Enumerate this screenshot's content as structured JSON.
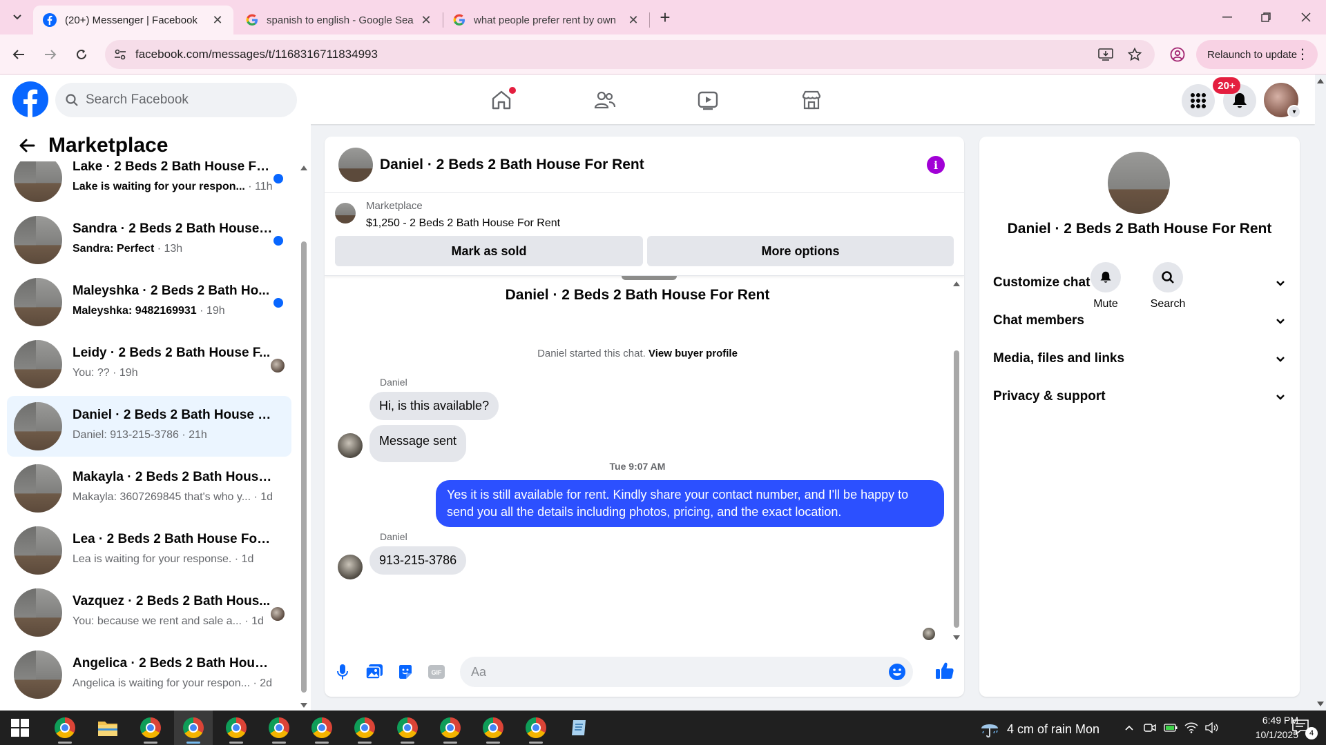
{
  "browser": {
    "tabs": [
      {
        "title": "(20+) Messenger | Facebook",
        "active": true
      },
      {
        "title": "spanish to english - Google Sea",
        "active": false
      },
      {
        "title": "what people prefer rent by own",
        "active": false
      }
    ],
    "url": "facebook.com/messages/t/1168316711834993",
    "relaunch_label": "Relaunch to update"
  },
  "fb": {
    "search_placeholder": "Search Facebook",
    "notification_badge": "20+",
    "brand_color": "#0866ff"
  },
  "sidebar": {
    "title": "Marketplace",
    "chats": [
      {
        "name": "Lake · 2 Beds 2 Bath House Fo...",
        "preview": "Lake is waiting for your respon...",
        "time": " · 11h",
        "unread": true,
        "status": "dot"
      },
      {
        "name": "Sandra · 2 Beds 2 Bath House ...",
        "preview": "Sandra: Perfect",
        "time": " · 13h",
        "unread": true,
        "status": "dot"
      },
      {
        "name": "Maleyshka · 2 Beds 2 Bath Ho...",
        "preview": "Maleyshka: 9482169931",
        "time": " · 19h",
        "unread": true,
        "status": "dot"
      },
      {
        "name": "Leidy · 2 Beds 2 Bath House F...",
        "preview": "You: ??",
        "time": " · 19h",
        "unread": false,
        "status": "seen"
      },
      {
        "name": "Daniel · 2 Beds 2 Bath House Fo...",
        "preview": "Daniel: 913-215-3786",
        "time": " · 21h",
        "unread": false,
        "status": "none",
        "active": true
      },
      {
        "name": "Makayla · 2 Beds 2 Bath House F...",
        "preview": "Makayla: 3607269845 that's who y...",
        "time": " · 1d",
        "unread": false,
        "status": "none"
      },
      {
        "name": "Lea · 2 Beds 2 Bath House For R...",
        "preview": "Lea is waiting for your response.",
        "time": " · 1d",
        "unread": false,
        "status": "none"
      },
      {
        "name": "Vazquez · 2 Beds 2 Bath Hous...",
        "preview": "You: because we rent and sale a...",
        "time": " · 1d",
        "unread": false,
        "status": "seen"
      },
      {
        "name": "Angelica · 2 Beds 2 Bath House ...",
        "preview": "Angelica is waiting for your respon...",
        "time": " · 2d",
        "unread": false,
        "status": "none"
      }
    ]
  },
  "conversation": {
    "title": "Daniel · 2 Beds 2 Bath House For Rent",
    "listing": {
      "label": "Marketplace",
      "price_title": "$1,250 - 2 Beds 2 Bath House For Rent",
      "mark_sold": "Mark as sold",
      "more_options": "More options"
    },
    "intro_title": "Daniel · 2 Beds 2 Bath House For Rent",
    "started_text": "Daniel started this chat. ",
    "view_profile": "View buyer profile",
    "sender_name": "Daniel",
    "messages": {
      "m1": "Hi, is this available?",
      "m2": "Message sent",
      "timestamp": "Tue 9:07 AM",
      "reply": "Yes it is still available for rent. Kindly share your contact number, and I'll be happy to send you all the details including photos, pricing, and the exact location.",
      "m3": "913-215-3786"
    },
    "composer_placeholder": "Aa",
    "out_bubble_color": "#2c50ff"
  },
  "info": {
    "name": "Daniel · 2 Beds 2 Bath House For Rent",
    "actions": {
      "mute": "Mute",
      "search": "Search"
    },
    "sections": [
      "Customize chat",
      "Chat members",
      "Media, files and links",
      "Privacy & support"
    ]
  },
  "taskbar": {
    "weather": "4 cm of rain Mon",
    "time": "6:49 PM",
    "date": "10/1/2025",
    "notifications": "4"
  }
}
